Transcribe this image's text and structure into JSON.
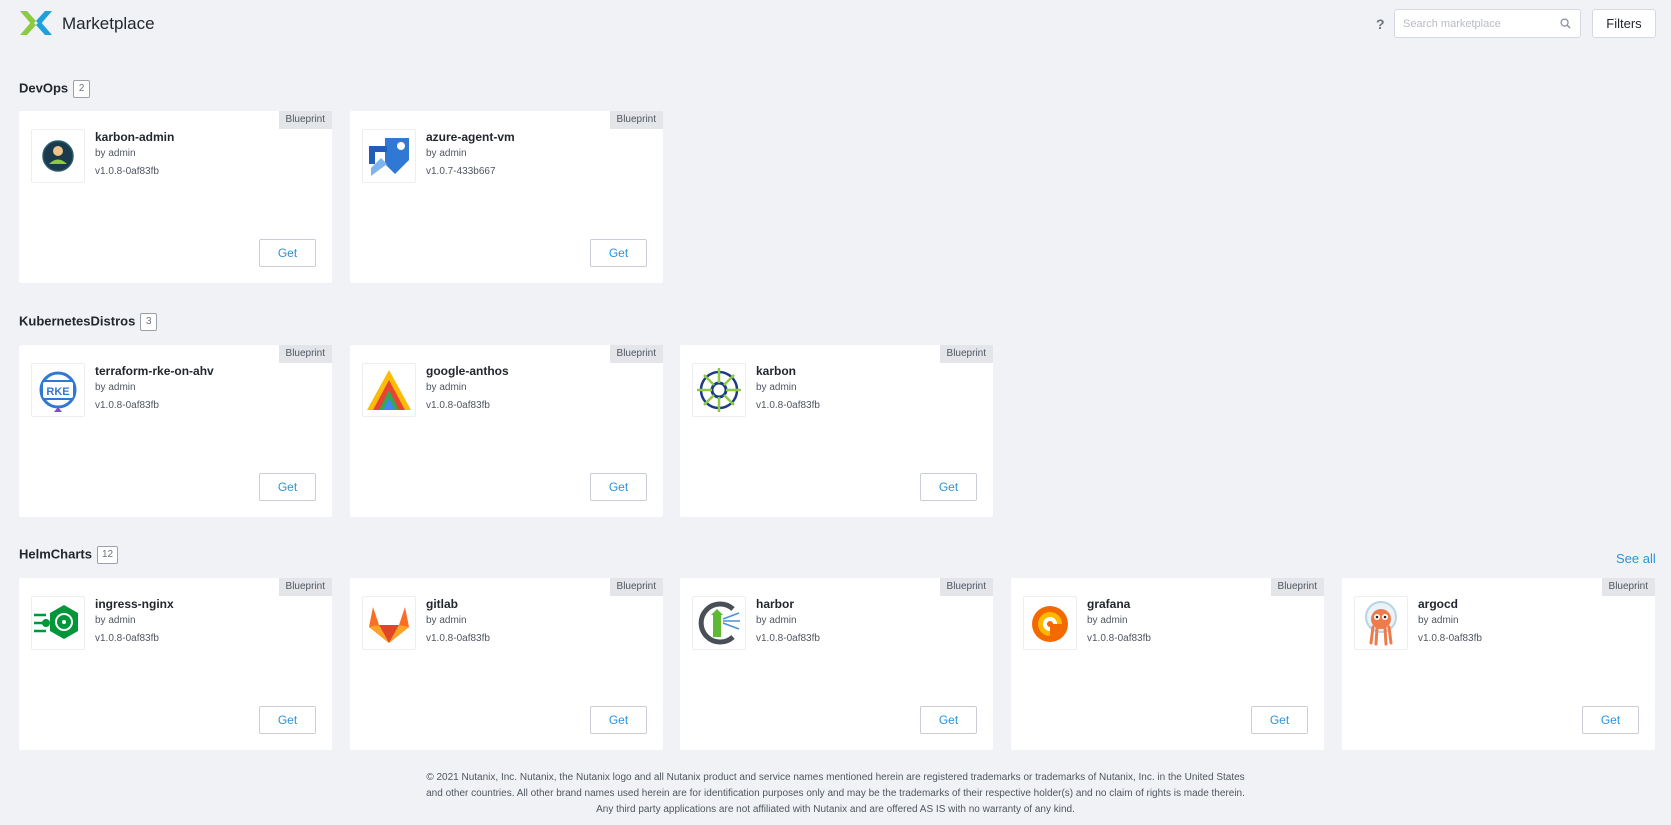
{
  "header": {
    "title": "Marketplace",
    "help": "?",
    "search_placeholder": "Search marketplace",
    "filters_label": "Filters"
  },
  "sections": [
    {
      "title": "DevOps",
      "count": "2",
      "cards": [
        {
          "name": "karbon-admin",
          "author": "by admin",
          "version": "v1.0.8-0af83fb",
          "badge": "Blueprint",
          "get": "Get",
          "icon": "karbon-admin-icon"
        },
        {
          "name": "azure-agent-vm",
          "author": "by admin",
          "version": "v1.0.7-433b667",
          "badge": "Blueprint",
          "get": "Get",
          "icon": "azure-devops-icon"
        }
      ]
    },
    {
      "title": "KubernetesDistros",
      "count": "3",
      "cards": [
        {
          "name": "terraform-rke-on-ahv",
          "author": "by admin",
          "version": "v1.0.8-0af83fb",
          "badge": "Blueprint",
          "get": "Get",
          "icon": "rke-icon"
        },
        {
          "name": "google-anthos",
          "author": "by admin",
          "version": "v1.0.8-0af83fb",
          "badge": "Blueprint",
          "get": "Get",
          "icon": "anthos-icon"
        },
        {
          "name": "karbon",
          "author": "by admin",
          "version": "v1.0.8-0af83fb",
          "badge": "Blueprint",
          "get": "Get",
          "icon": "karbon-wheel-icon"
        }
      ]
    },
    {
      "title": "HelmCharts",
      "count": "12",
      "see_all": "See all",
      "cards": [
        {
          "name": "ingress-nginx",
          "author": "by admin",
          "version": "v1.0.8-0af83fb",
          "badge": "Blueprint",
          "get": "Get",
          "icon": "ingress-nginx-icon"
        },
        {
          "name": "gitlab",
          "author": "by admin",
          "version": "v1.0.8-0af83fb",
          "badge": "Blueprint",
          "get": "Get",
          "icon": "gitlab-icon"
        },
        {
          "name": "harbor",
          "author": "by admin",
          "version": "v1.0.8-0af83fb",
          "badge": "Blueprint",
          "get": "Get",
          "icon": "harbor-icon"
        },
        {
          "name": "grafana",
          "author": "by admin",
          "version": "v1.0.8-0af83fb",
          "badge": "Blueprint",
          "get": "Get",
          "icon": "grafana-icon"
        },
        {
          "name": "argocd",
          "author": "by admin",
          "version": "v1.0.8-0af83fb",
          "badge": "Blueprint",
          "get": "Get",
          "icon": "argocd-icon"
        }
      ]
    }
  ],
  "footer": {
    "line1": "© 2021 Nutanix, Inc. Nutanix, the Nutanix logo and all Nutanix product and service names mentioned herein are registered trademarks or trademarks of Nutanix, Inc. in the United States",
    "line2": "and other countries. All other brand names used herein are for identification purposes only and may be the trademarks of their respective holder(s) and no claim of rights is made therein.",
    "line3": "Any third party applications are not affiliated with Nutanix and are offered AS IS with no warranty of any kind."
  },
  "colors": {
    "accent": "#2d93d8",
    "background": "#f1f2f5"
  }
}
